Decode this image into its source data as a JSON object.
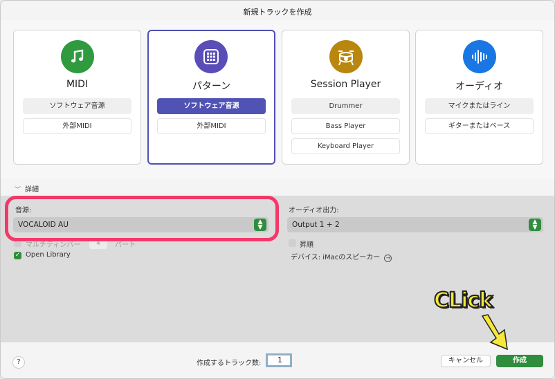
{
  "window": {
    "title": "新規トラックを作成"
  },
  "cards": [
    {
      "title": "MIDI",
      "icon": "music-note-icon",
      "color": "#2f9a3e",
      "options": [
        {
          "label": "ソフトウェア音源",
          "state": "gray"
        },
        {
          "label": "外部MIDI",
          "state": "normal"
        }
      ]
    },
    {
      "title": "パターン",
      "icon": "grid-icon",
      "color": "#5a4db8",
      "options": [
        {
          "label": "ソフトウェア音源",
          "state": "active"
        },
        {
          "label": "外部MIDI",
          "state": "normal"
        }
      ]
    },
    {
      "title": "Session Player",
      "icon": "drum-icon",
      "color": "#b9860e",
      "options": [
        {
          "label": "Drummer",
          "state": "gray"
        },
        {
          "label": "Bass Player",
          "state": "normal"
        },
        {
          "label": "Keyboard Player",
          "state": "normal"
        }
      ]
    },
    {
      "title": "オーディオ",
      "icon": "waveform-icon",
      "color": "#1877e3",
      "options": [
        {
          "label": "マイクまたはライン",
          "state": "gray"
        },
        {
          "label": "ギターまたはベース",
          "state": "normal"
        }
      ]
    }
  ],
  "details": {
    "toggle_label": "詳細",
    "instrument_label": "音源:",
    "instrument_value": "VOCALOID AU",
    "multitimbral_label": "マルチティンバー",
    "multitimbral_value": "4",
    "multitimbral_unit": "パート",
    "open_library_label": "Open Library",
    "audio_output_label": "オーディオ出力:",
    "audio_output_value": "Output 1 + 2",
    "ascending_label": "昇順",
    "device_label": "デバイス: iMacのスピーカー"
  },
  "footer": {
    "help_label": "?",
    "count_label": "作成するトラック数:",
    "count_value": "1",
    "cancel_label": "キャンセル",
    "create_label": "作成"
  },
  "annotation": {
    "text": "CLick",
    "color": "#f5e83a",
    "highlight_color": "#f2386a"
  }
}
